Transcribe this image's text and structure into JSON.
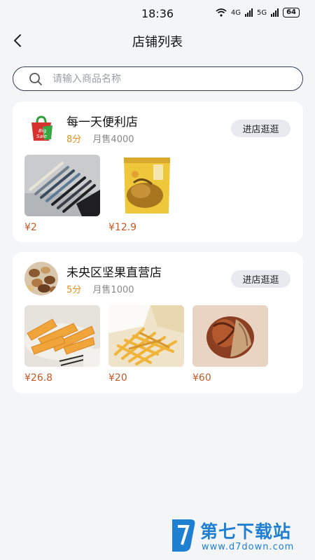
{
  "status_bar": {
    "time": "18:36",
    "battery": "64",
    "net1": "4G",
    "net2": "5G"
  },
  "header": {
    "title": "店铺列表"
  },
  "search": {
    "placeholder": "请输入商品名称",
    "value": ""
  },
  "shops": [
    {
      "name": "每一天便利店",
      "score": "8分",
      "sales": "月售4000",
      "enter_label": "进店逛逛",
      "logo_text": "Big Sale",
      "products": [
        {
          "price": "¥2",
          "image": "pens"
        },
        {
          "price": "¥12.9",
          "image": "snack-bag"
        }
      ]
    },
    {
      "name": "未央区坚果直营店",
      "score": "5分",
      "sales": "月售1000",
      "enter_label": "进店逛逛",
      "products": [
        {
          "price": "¥26.8",
          "image": "sweet-potato-chips"
        },
        {
          "price": "¥20",
          "image": "fries"
        },
        {
          "price": "¥60",
          "image": "pecans"
        }
      ]
    }
  ],
  "watermark": {
    "title": "第七下载站",
    "url": "www.d7down.com"
  },
  "colors": {
    "price": "#c35a24",
    "score": "#d8951f",
    "search_border": "#2f3b52",
    "watermark": "#1f7fd1"
  }
}
